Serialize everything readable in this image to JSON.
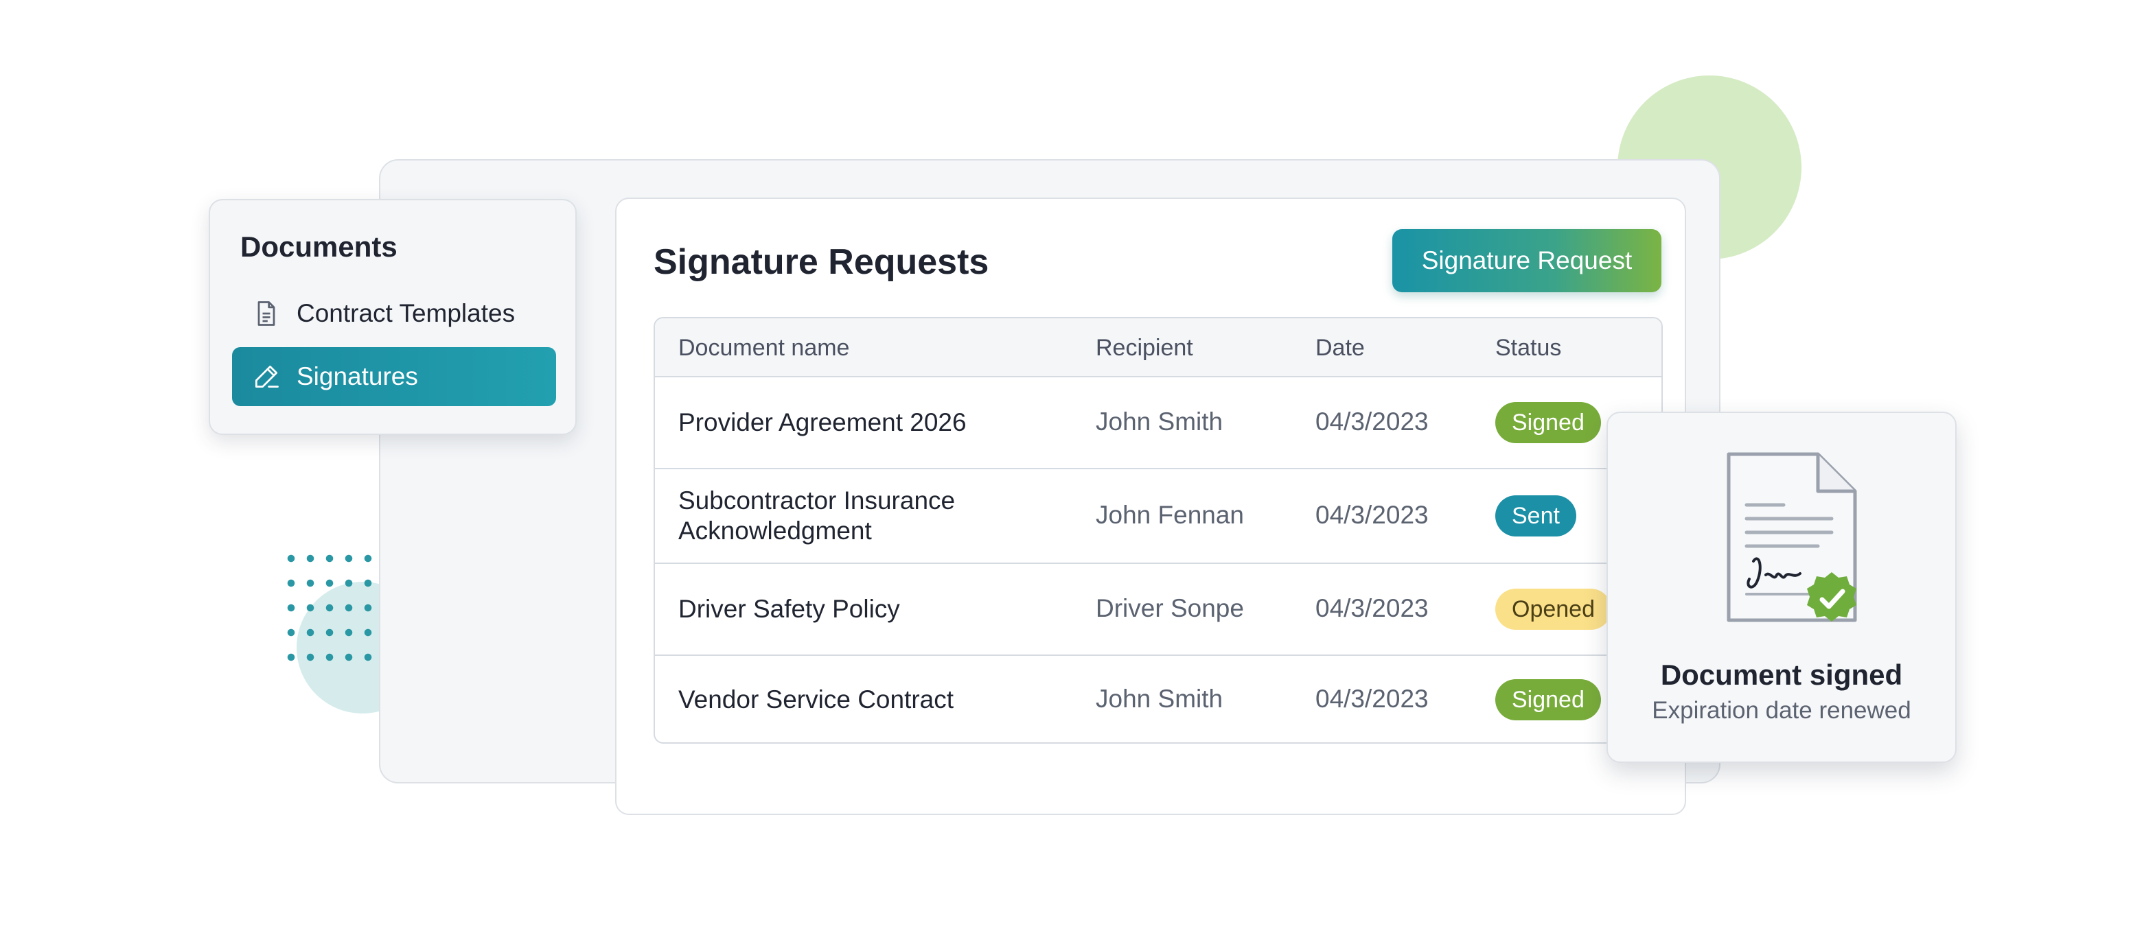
{
  "sidebar": {
    "title": "Documents",
    "items": [
      {
        "label": "Contract Templates",
        "icon": "document-icon"
      },
      {
        "label": "Signatures",
        "icon": "pen-icon",
        "active": true
      }
    ]
  },
  "main": {
    "title": "Signature Requests",
    "primary_button": "Signature Request",
    "table": {
      "headers": [
        "Document name",
        "Recipient",
        "Date",
        "Status"
      ],
      "rows": [
        {
          "name": "Provider Agreement 2026",
          "recipient": "John Smith",
          "date": "04/3/2023",
          "status": "Signed"
        },
        {
          "name": "Subcontractor Insurance Acknowledgment",
          "name_line1": "Subcontractor Insurance",
          "name_line2": "Acknowledgment",
          "recipient": "John Fennan",
          "date": "04/3/2023",
          "status": "Sent"
        },
        {
          "name": "Driver Safety Policy",
          "recipient": "Driver Sonpe",
          "date": "04/3/2023",
          "status": "Opened"
        },
        {
          "name": "Vendor Service Contract",
          "recipient": "John Smith",
          "date": "04/3/2023",
          "status": "Signed"
        }
      ]
    }
  },
  "notification": {
    "title": "Document signed",
    "subtitle": "Expiration date renewed",
    "icon": "signed-document-icon",
    "badge_icon": "check-icon"
  },
  "colors": {
    "accent_teal": "#1b8a9e",
    "accent_green": "#78ac3a",
    "status_signed": "#78ac3a",
    "status_sent": "#1c90a6",
    "status_opened": "#fbe08a"
  }
}
